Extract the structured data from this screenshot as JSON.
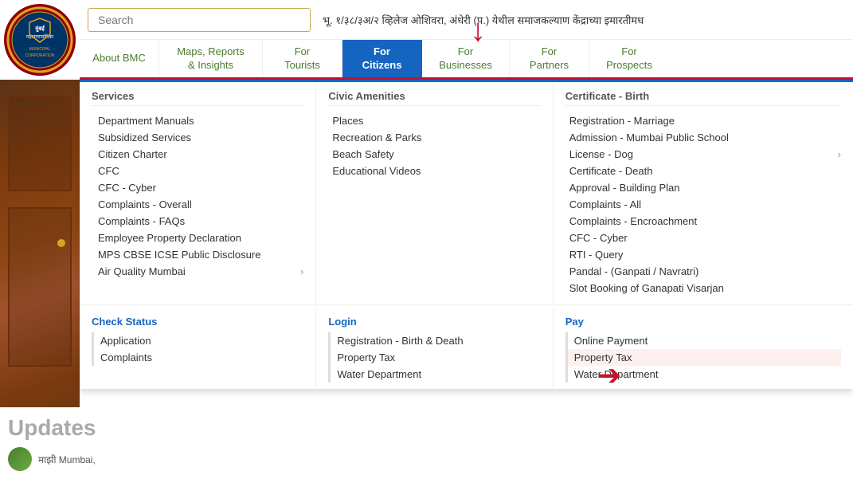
{
  "header": {
    "search_placeholder": "Search",
    "marquee_text": "भू. १/३८/३अ/२ व्हिलेज ओशिवरा, अंधेरी (प.) येथील समाजकल्याण केंद्राच्या इमारतीमध"
  },
  "navbar": {
    "items": [
      {
        "id": "about-bmc",
        "label": "About\nBMC",
        "active": false
      },
      {
        "id": "maps-reports",
        "label": "Maps, Reports\n& Insights",
        "active": false
      },
      {
        "id": "for-tourists",
        "label": "For\nTourists",
        "active": false
      },
      {
        "id": "for-citizens",
        "label": "For\nCitizens",
        "active": true
      },
      {
        "id": "for-businesses",
        "label": "For\nBusinesses",
        "active": false
      },
      {
        "id": "for-partners",
        "label": "For\nPartners",
        "active": false
      },
      {
        "id": "for-prospects",
        "label": "For\nProspects",
        "active": false
      }
    ]
  },
  "dropdown": {
    "col1": {
      "header": "Services",
      "items": [
        "Department Manuals",
        "Subsidized Services",
        "Citizen Charter",
        "CFC",
        "CFC - Cyber",
        "Complaints - Overall",
        "Complaints - FAQs",
        "Employee Property Declaration",
        "MPS CBSE ICSE Public Disclosure",
        "Air Quality Mumbai"
      ],
      "has_chevron": [
        false,
        false,
        false,
        false,
        false,
        false,
        false,
        false,
        false,
        true
      ]
    },
    "col2": {
      "header": "Civic Amenities",
      "items": [
        "Places",
        "Recreation & Parks",
        "Beach Safety",
        "Educational Videos"
      ]
    },
    "col3": {
      "header": "Certificate - Birth",
      "items": [
        "Registration - Marriage",
        "Admission - Mumbai Public School",
        "License - Dog",
        "Certificate - Death",
        "Approval - Building Plan",
        "Complaints - All",
        "Complaints - Encroachment",
        "CFC - Cyber",
        "RTI - Query",
        "Pandal - (Ganpati / Navratri)",
        "Slot Booking of Ganapati Visarjan"
      ],
      "has_chevron": [
        false,
        false,
        true,
        false,
        false,
        false,
        false,
        false,
        false,
        false,
        false
      ]
    },
    "check_status": {
      "header": "Check Status",
      "items": [
        "Application",
        "Complaints"
      ]
    },
    "login": {
      "header": "Login",
      "items": [
        "Registration - Birth & Death",
        "Property Tax",
        "Water Department"
      ]
    },
    "pay": {
      "header": "Pay",
      "items": [
        "Online Payment",
        "Property Tax",
        "Water Department"
      ]
    }
  },
  "updates": {
    "title": "Updates",
    "items": [
      {
        "text": "माझी Mumbai,"
      }
    ]
  },
  "icons": {
    "down_arrow": "▼",
    "right_arrow": "➜",
    "chevron_right": "›"
  },
  "colors": {
    "nav_active_bg": "#1565c0",
    "nav_active_text": "#ffffff",
    "nav_green": "#4a7c2f",
    "red_accent": "#c8102e",
    "check_status_blue": "#1565c0",
    "login_blue": "#1565c0",
    "pay_blue": "#1565c0"
  }
}
